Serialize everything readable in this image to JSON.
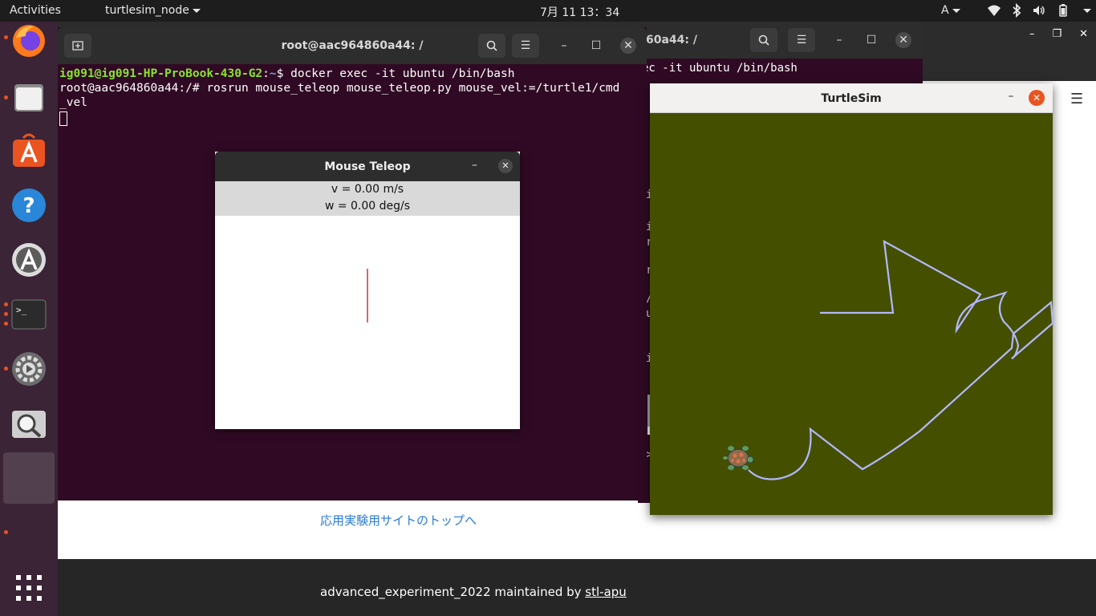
{
  "topbar": {
    "activities": "Activities",
    "app_menu": "turtlesim_node",
    "clock": "7月 11 13：34",
    "input_source": "A"
  },
  "dock": {
    "items": [
      "firefox-icon",
      "files-icon",
      "software-center-icon",
      "help-icon",
      "software-updater-icon",
      "terminal-icon",
      "settings-icon",
      "image-viewer-icon",
      "active-window-icon",
      "show-apps-icon"
    ]
  },
  "browser": {
    "top_link": "応用実験用サイトのトップへ",
    "footer_text": "advanced_experiment_2022 maintained by ",
    "footer_link": "stl-apu"
  },
  "terminal_back": {
    "title": "60a44: /",
    "line1": "ec -it ubuntu /bin/bash"
  },
  "terminal": {
    "title": "root@aac964860a44: /",
    "user_host": "ig091@ig091-HP-ProBook-430-G2",
    "path": "~",
    "cmd1": "$ docker exec -it ubuntu /bin/bash",
    "line2": "root@aac964860a44:/# rosrun mouse_teleop mouse_teleop.py mouse_vel:=/turtle1/cmd",
    "line3": "_vel"
  },
  "mouse_teleop": {
    "title": "Mouse Teleop",
    "v_text": "v = 0.00 m/s",
    "w_text": "w = 0.00 deg/s"
  },
  "turtlesim": {
    "title": "TurtleSim",
    "background_color": "#454f00",
    "pen_color": "#b3b8ff"
  },
  "colors": {
    "ubuntu_orange": "#e95420",
    "terminal_bg": "#300a24"
  }
}
